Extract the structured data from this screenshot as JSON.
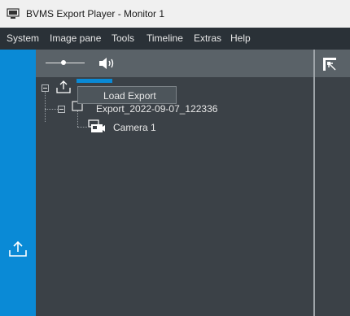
{
  "window": {
    "title": "BVMS Export Player - Monitor 1"
  },
  "menu": {
    "items": [
      "System",
      "Image pane",
      "Tools",
      "Timeline",
      "Extras",
      "Help"
    ]
  },
  "toolbar": {
    "volume_level": 0.45
  },
  "tree": {
    "export_label": "Export_2022-09-07_122336",
    "camera_label": "Camera 1"
  },
  "context_menu": {
    "items": [
      "Load Export"
    ]
  },
  "colors": {
    "accent": "#0a8ad6",
    "menubar": "#2a3137",
    "panel": "#3b4147",
    "toolbar": "#5a6268"
  }
}
